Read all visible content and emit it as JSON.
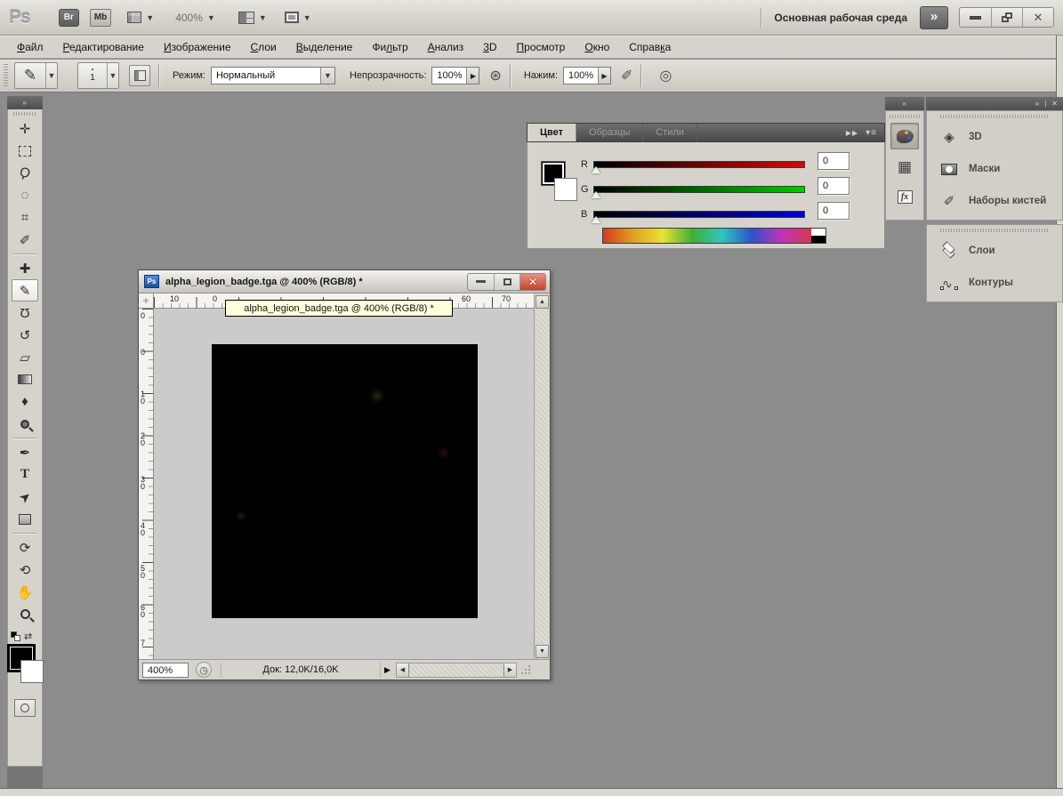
{
  "titlebar": {
    "logo": "Ps",
    "bridge_label": "Br",
    "minibridge_label": "Mb",
    "zoom_level": "400%",
    "workspace": "Основная рабочая среда",
    "expand_chevrons": "»"
  },
  "menubar": {
    "items": [
      {
        "pre": "",
        "m": "Ф",
        "post": "айл"
      },
      {
        "pre": "",
        "m": "Р",
        "post": "едактирование"
      },
      {
        "pre": "",
        "m": "И",
        "post": "зображение"
      },
      {
        "pre": "",
        "m": "С",
        "post": "лои"
      },
      {
        "pre": "",
        "m": "В",
        "post": "ыделение"
      },
      {
        "pre": "Фи",
        "m": "л",
        "post": "ьтр"
      },
      {
        "pre": "",
        "m": "А",
        "post": "нализ"
      },
      {
        "pre": "",
        "m": "3",
        "post": "D"
      },
      {
        "pre": "",
        "m": "П",
        "post": "росмотр"
      },
      {
        "pre": "",
        "m": "О",
        "post": "кно"
      },
      {
        "pre": "Справ",
        "m": "к",
        "post": "а"
      }
    ]
  },
  "optionsbar": {
    "brush_size": "1",
    "mode_label": "Режим:",
    "mode_value": "Нормальный",
    "opacity_label": "Непрозрачность:",
    "opacity_value": "100%",
    "flow_label": "Нажим:",
    "flow_value": "100%"
  },
  "toolbar": {
    "tools": [
      {
        "name": "move-tool",
        "glyph": "✛"
      },
      {
        "name": "marquee-tool",
        "glyph": ""
      },
      {
        "name": "lasso-tool",
        "glyph": "Ϙ"
      },
      {
        "name": "quick-selection-tool",
        "glyph": "◌"
      },
      {
        "name": "crop-tool",
        "glyph": "⌗"
      },
      {
        "name": "eyedropper-tool",
        "glyph": "✐"
      },
      {
        "name": "healing-brush-tool",
        "glyph": "✚"
      },
      {
        "name": "brush-tool",
        "glyph": "✎"
      },
      {
        "name": "clone-stamp-tool",
        "glyph": "Ω"
      },
      {
        "name": "history-brush-tool",
        "glyph": "↺"
      },
      {
        "name": "eraser-tool",
        "glyph": "▱"
      },
      {
        "name": "gradient-tool",
        "glyph": ""
      },
      {
        "name": "blur-tool",
        "glyph": "♦"
      },
      {
        "name": "dodge-tool",
        "glyph": ""
      },
      {
        "name": "pen-tool",
        "glyph": "✒"
      },
      {
        "name": "type-tool",
        "glyph": "Т"
      },
      {
        "name": "path-selection-tool",
        "glyph": "➤"
      },
      {
        "name": "rectangle-tool",
        "glyph": ""
      },
      {
        "name": "3d-rotate-tool",
        "glyph": "⟳"
      },
      {
        "name": "3d-orbit-tool",
        "glyph": "⟲"
      },
      {
        "name": "hand-tool",
        "glyph": "✋"
      },
      {
        "name": "zoom-tool",
        "glyph": ""
      }
    ],
    "foreground_color": "#000000",
    "background_color": "#ffffff"
  },
  "color_panel": {
    "tabs": [
      "Цвет",
      "Образцы",
      "Стили"
    ],
    "channels": [
      {
        "label": "R",
        "value": "0",
        "color": "#ff0000"
      },
      {
        "label": "G",
        "value": "0",
        "color": "#00d800"
      },
      {
        "label": "B",
        "value": "0",
        "color": "#0000ff"
      }
    ],
    "foreground_color": "#000000",
    "background_color": "#ffffff"
  },
  "dock": {
    "styles_fx_label": "fx",
    "groups": [
      {
        "items": [
          "3D",
          "Маски",
          "Наборы кистей"
        ]
      },
      {
        "items": [
          "Слои",
          "Контуры"
        ]
      }
    ]
  },
  "document": {
    "icon_label": "Ps",
    "title": "alpha_legion_badge.tga @ 400% (RGB/8) *",
    "ruler_tooltip": "alpha_legion_badge.tga @ 400% (RGB/8) *",
    "zoom_value": "400%",
    "status_info": "Док: 12,0K/16,0K",
    "h_ruler_labels": [
      "10",
      "0",
      "60",
      "70"
    ],
    "v_ruler_labels": [
      "0",
      "0",
      "10",
      "20",
      "30",
      "40",
      "50",
      "60",
      "7"
    ]
  }
}
